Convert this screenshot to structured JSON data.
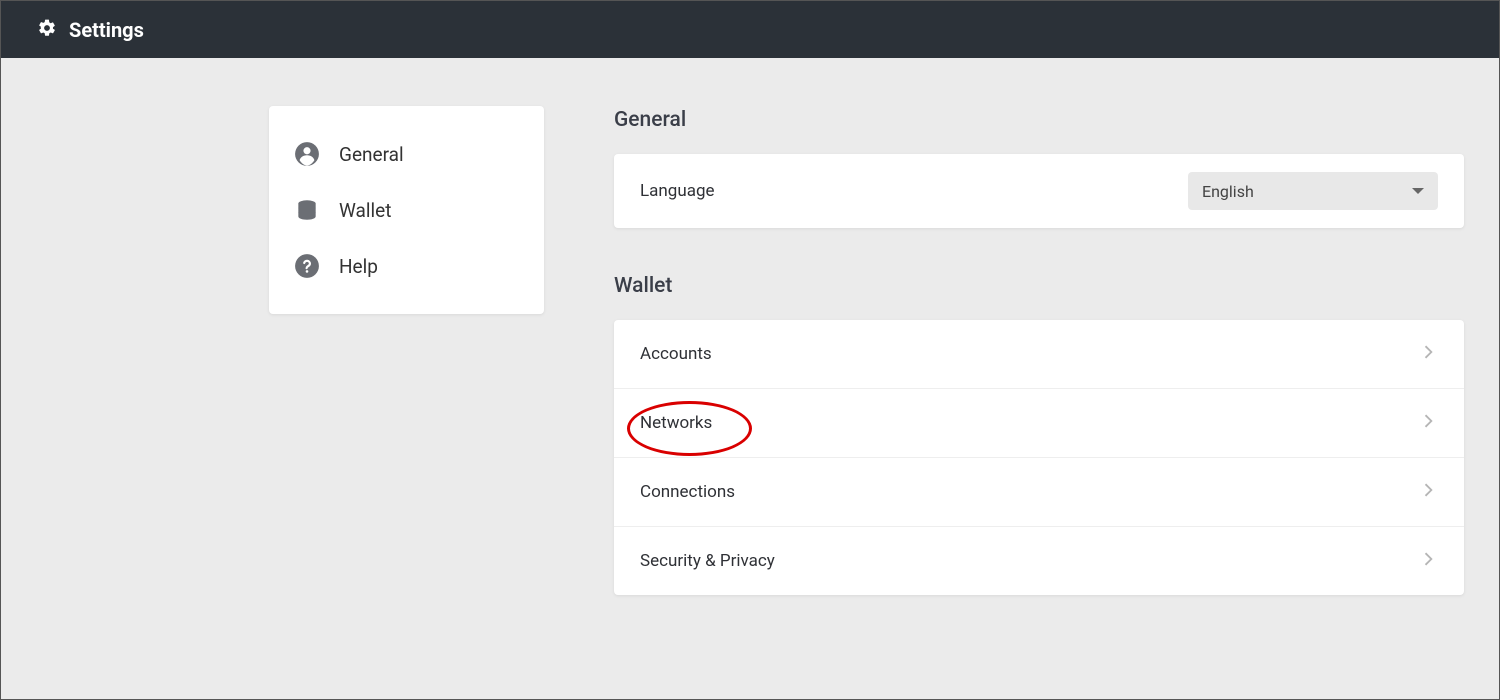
{
  "header": {
    "title": "Settings"
  },
  "sidebar": {
    "items": [
      {
        "label": "General"
      },
      {
        "label": "Wallet"
      },
      {
        "label": "Help"
      }
    ]
  },
  "sections": {
    "general": {
      "title": "General",
      "language_label": "Language",
      "language_value": "English"
    },
    "wallet": {
      "title": "Wallet",
      "rows": [
        {
          "label": "Accounts"
        },
        {
          "label": "Networks"
        },
        {
          "label": "Connections"
        },
        {
          "label": "Security & Privacy"
        }
      ]
    }
  }
}
